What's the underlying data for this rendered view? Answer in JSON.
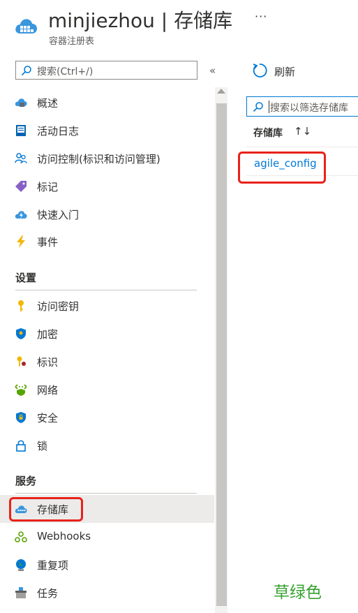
{
  "header": {
    "title": "minjiezhou | 存储库",
    "subtitle": "容器注册表",
    "more": "···",
    "icon": "container-registry-cloud-icon"
  },
  "sidebar": {
    "search_placeholder": "搜索(Ctrl+/)",
    "collapse": "«",
    "items": [
      {
        "label": "概述",
        "icon": "overview-cloud-icon"
      },
      {
        "label": "活动日志",
        "icon": "activity-log-icon"
      },
      {
        "label": "访问控制(标识和访问管理)",
        "icon": "people-icon"
      },
      {
        "label": "标记",
        "icon": "tag-icon"
      },
      {
        "label": "快速入门",
        "icon": "quickstart-cloud-icon"
      },
      {
        "label": "事件",
        "icon": "lightning-icon"
      }
    ],
    "sections": [
      {
        "title": "设置",
        "items": [
          {
            "label": "访问密钥",
            "icon": "key-icon"
          },
          {
            "label": "加密",
            "icon": "shield-icon"
          },
          {
            "label": "标识",
            "icon": "identity-key-icon"
          },
          {
            "label": "网络",
            "icon": "network-icon"
          },
          {
            "label": "安全",
            "icon": "security-shield-icon"
          },
          {
            "label": "锁",
            "icon": "lock-icon"
          }
        ]
      },
      {
        "title": "服务",
        "items": [
          {
            "label": "存储库",
            "icon": "repository-cloud-icon",
            "active": true
          },
          {
            "label": "Webhooks",
            "icon": "webhook-icon"
          },
          {
            "label": "重复项",
            "icon": "globe-icon"
          },
          {
            "label": "任务",
            "icon": "tasks-icon"
          }
        ]
      }
    ]
  },
  "main": {
    "refresh_label": "刷新",
    "filter_placeholder": "搜索以筛选存储库",
    "column_header": "存储库",
    "sort_icon": "↑↓",
    "repositories": [
      "agile_config"
    ]
  },
  "annotation": "草绿色",
  "colors": {
    "accent": "#0078d4",
    "highlight": "#e8221a",
    "annotation": "#36a12f"
  }
}
